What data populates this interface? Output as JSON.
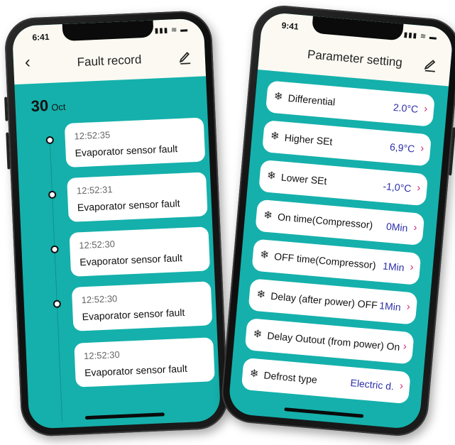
{
  "left_phone": {
    "status_time": "6:41",
    "title": "Fault record",
    "date_day": "30",
    "date_month": "Oct",
    "records": [
      {
        "time": "12:52:35",
        "message": "Evaporator sensor fault"
      },
      {
        "time": "12:52:31",
        "message": "Evaporator sensor fault"
      },
      {
        "time": "12:52:30",
        "message": "Evaporator sensor fault"
      },
      {
        "time": "12:52:30",
        "message": "Evaporator sensor fault"
      },
      {
        "time": "12:52:30",
        "message": "Evaporator sensor fault"
      }
    ]
  },
  "right_phone": {
    "status_time": "9:41",
    "title": "Parameter setting",
    "params": [
      {
        "name": "Differential",
        "value": "2.0°C"
      },
      {
        "name": "Higher SEt",
        "value": "6,9°C"
      },
      {
        "name": "Lower SEt",
        "value": "-1,0°C"
      },
      {
        "name": "On time(Compressor)",
        "value": "0Min"
      },
      {
        "name": "OFF time(Compressor)",
        "value": "1Min"
      },
      {
        "name": "Delay (after power) OFF",
        "value": "1Min"
      },
      {
        "name": "Delay Outout (from power) On",
        "value": ""
      },
      {
        "name": "Defrost type",
        "value": "Electric d."
      }
    ]
  },
  "glyphs": {
    "back": "‹",
    "chevron": "›",
    "snowflake": "❄",
    "signal": "▮▮▮ ≋ ▬"
  },
  "colors": {
    "screen_bg": "#15b0ab",
    "header_bg": "#fbf9f2",
    "value_text": "#2c2fa8",
    "chevron": "#d0287a"
  }
}
